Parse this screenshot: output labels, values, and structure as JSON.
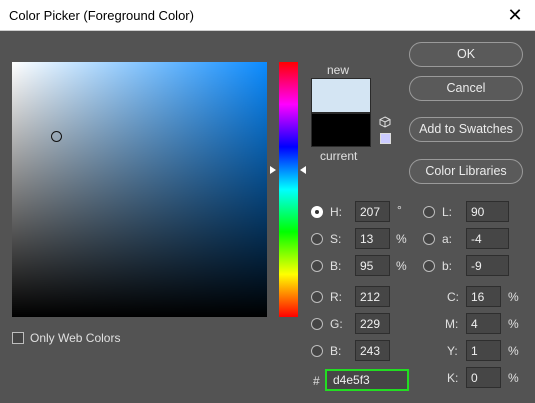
{
  "window": {
    "title": "Color Picker (Foreground Color)"
  },
  "buttons": {
    "ok": "OK",
    "cancel": "Cancel",
    "add_to_swatches": "Add to Swatches",
    "color_libraries": "Color Libraries"
  },
  "preview": {
    "new_label": "new",
    "current_label": "current",
    "new_color": "#d4e5f3",
    "current_color": "#000000"
  },
  "only_web_colors": {
    "label": "Only Web Colors",
    "checked": false
  },
  "hsb": {
    "h": {
      "label": "H:",
      "value": "207",
      "unit": "°",
      "selected": true
    },
    "s": {
      "label": "S:",
      "value": "13",
      "unit": "%"
    },
    "b": {
      "label": "B:",
      "value": "95",
      "unit": "%"
    }
  },
  "rgb": {
    "r": {
      "label": "R:",
      "value": "212"
    },
    "g": {
      "label": "G:",
      "value": "229"
    },
    "b": {
      "label": "B:",
      "value": "243"
    }
  },
  "lab": {
    "l": {
      "label": "L:",
      "value": "90"
    },
    "a": {
      "label": "a:",
      "value": "-4"
    },
    "b": {
      "label": "b:",
      "value": "-9"
    }
  },
  "cmyk": {
    "c": {
      "label": "C:",
      "value": "16",
      "unit": "%"
    },
    "m": {
      "label": "M:",
      "value": "4",
      "unit": "%"
    },
    "y": {
      "label": "Y:",
      "value": "1",
      "unit": "%"
    },
    "k": {
      "label": "K:",
      "value": "0",
      "unit": "%"
    }
  },
  "hex": {
    "prefix": "#",
    "value": "d4e5f3"
  },
  "colors": {
    "background": "#535353",
    "hex_highlight": "#22dd22",
    "field_hue": "#0b8bff"
  }
}
